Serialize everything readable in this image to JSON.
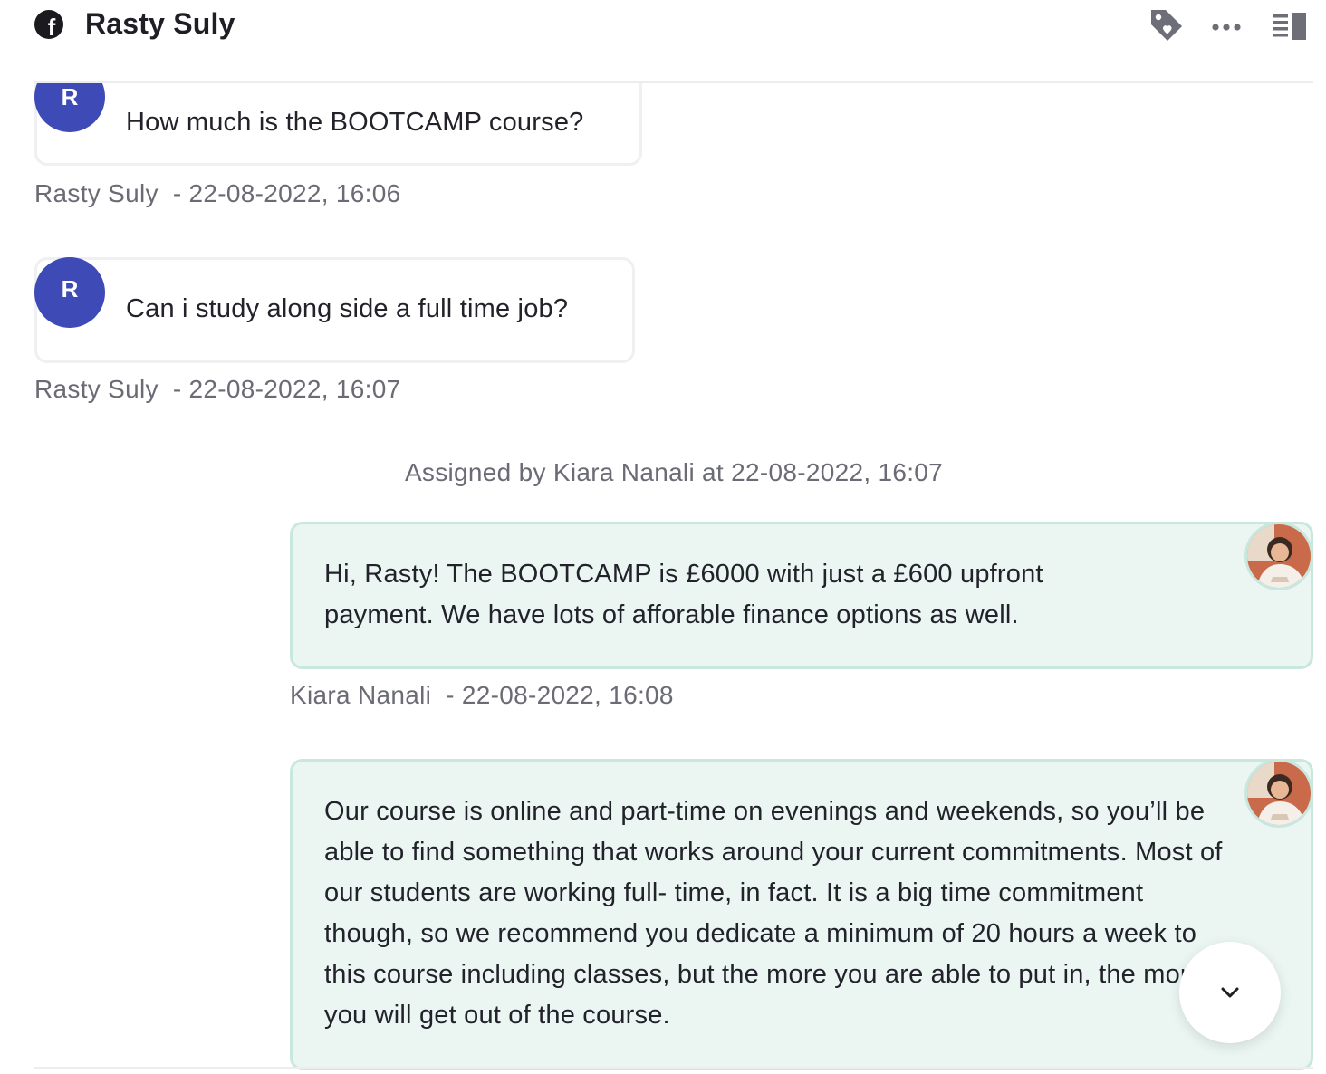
{
  "header": {
    "channel_icon": "facebook-icon",
    "contact_name": "Rasty Suly",
    "actions": [
      {
        "name": "tag-icon"
      },
      {
        "name": "more-options-icon"
      },
      {
        "name": "toggle-side-panel-icon"
      }
    ]
  },
  "messages": [
    {
      "direction": "incoming",
      "avatar_initial": "R",
      "text": "How much is the BOOTCAMP course?",
      "sender": "Rasty Suly",
      "timestamp": "- 22-08-2022, 16:06"
    },
    {
      "direction": "incoming",
      "avatar_initial": "R",
      "text": "Can i study along side a full time job?",
      "sender": "Rasty Suly",
      "timestamp": "- 22-08-2022, 16:07"
    },
    {
      "direction": "outgoing",
      "text": "Hi, Rasty! The BOOTCAMP is £6000 with just a £600 upfront payment. We have lots of afforable finance options as well.",
      "sender": "Kiara Nanali",
      "timestamp": "- 22-08-2022, 16:08"
    },
    {
      "direction": "outgoing",
      "text": "Our course is online and part-time on evenings and weekends, so you’ll be able to find something that works around your current commitments. Most of our students are working full- time, in fact. It is a big time commitment though, so we recommend you dedicate a minimum of 20 hours a week to this course including classes, but the more you are able to put in, the more you will get out of the course."
    }
  ],
  "system_note": "Assigned by Kiara Nanali at 22-08-2022, 16:07",
  "colors": {
    "incoming_avatar": "#3e4ab5",
    "outgoing_bubble": "#ebf6f3",
    "outgoing_border": "#c8e8df",
    "meta_text": "#6b6b75"
  }
}
